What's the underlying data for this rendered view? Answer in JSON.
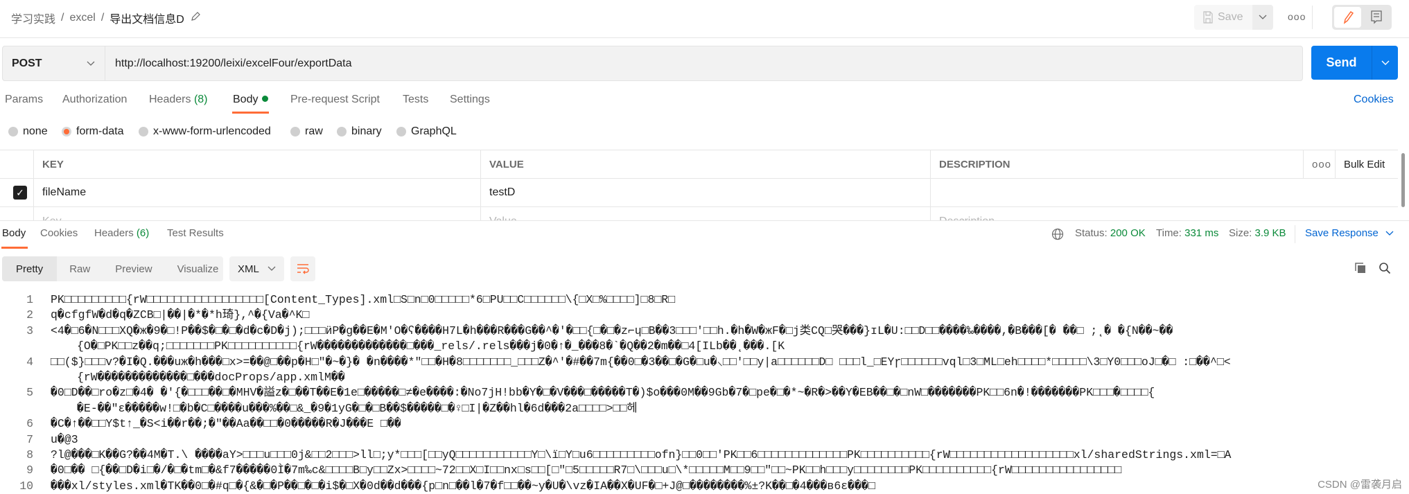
{
  "breadcrumb": {
    "items": [
      "学习实践",
      "excel"
    ],
    "current": "导出文档信息D",
    "separator": "/"
  },
  "header": {
    "save_label": "Save",
    "more": "ooo"
  },
  "request": {
    "method": "POST",
    "url": "http://localhost:19200/leixi/excelFour/exportData",
    "send_label": "Send"
  },
  "tabs": [
    {
      "label": "Params"
    },
    {
      "label": "Authorization"
    },
    {
      "label": "Headers",
      "count": "(8)"
    },
    {
      "label": "Body",
      "active": true
    },
    {
      "label": "Pre-request Script"
    },
    {
      "label": "Tests"
    },
    {
      "label": "Settings"
    }
  ],
  "cookies_label": "Cookies",
  "body_types": [
    {
      "label": "none"
    },
    {
      "label": "form-data",
      "selected": true
    },
    {
      "label": "x-www-form-urlencoded"
    },
    {
      "label": "raw"
    },
    {
      "label": "binary"
    },
    {
      "label": "GraphQL"
    }
  ],
  "table": {
    "headers": [
      "KEY",
      "VALUE",
      "DESCRIPTION"
    ],
    "more": "ooo",
    "bulk_edit": "Bulk Edit",
    "rows": [
      {
        "checked": true,
        "key": "fileName",
        "value": "testD",
        "description": ""
      }
    ],
    "placeholder": {
      "key": "Key",
      "value": "Value",
      "description": "Description"
    }
  },
  "response": {
    "tabs": [
      {
        "label": "Body",
        "active": true
      },
      {
        "label": "Cookies"
      },
      {
        "label": "Headers",
        "count": "(6)"
      },
      {
        "label": "Test Results"
      }
    ],
    "status_label": "Status:",
    "status": "200 OK",
    "time_label": "Time:",
    "time": "331 ms",
    "size_label": "Size:",
    "size": "3.9 KB",
    "save_response": "Save Response",
    "views": [
      "Pretty",
      "Raw",
      "Preview",
      "Visualize"
    ],
    "active_view": "Pretty",
    "format": "XML"
  },
  "colors": {
    "accent": "#FF6C37",
    "primary": "#097BED",
    "link": "#0265D2",
    "success": "#0B8A3A"
  },
  "code_lines": [
    {
      "n": "1",
      "segs": [
        [
          "PK□□□□□□□□□{rW□□□□□□□□□□□□□□□□□[Content_Types].xml□S□n□0□□□□□*6□PU□□C□□□□□□\\{□X□%□□□□]□8□R□",
          ""
        ]
      ]
    },
    {
      "n": "2",
      "segs": [
        [
          "q�cfgfW�d�q�ZCB□|��|�*�*h琦},^�{Va�^K□",
          ""
        ]
      ]
    },
    {
      "n": "3",
      "segs": [
        [
          "<4�□6�N□□□XQ�ж�9�□!P��$�□�□",
          ""
        ],
        [
          "�d�c�D�",
          ""
        ],
        [
          "j);□□□ӥP�g��E�M'O�ʕ����",
          ""
        ],
        [
          "H7L",
          ""
        ],
        [
          "�h���",
          ""
        ],
        [
          "R",
          ""
        ],
        [
          "���G��^�'�□□{□�□�z⌐ɥ□B��3□□□'□□h.�h�W�жF�□j类CQ□哭���}ɪL�U:□□D□□����‰����,�B���[�   ��□ ;˛� �{N��~��",
          ""
        ]
      ]
    },
    {
      "n": "",
      "cont": true,
      "segs": [
        [
          "{O�□PK□□z��q;□□□□□□□PK□□□□□□□□□□{rW�������������□���_rels/.rels���j�0�↑�_���8�`�Q��2�m��□4[ILb��˛���.[K",
          ""
        ]
      ]
    },
    {
      "n": "4",
      "segs": [
        [
          "□□($}□□□v?�I�Q.���uж�h���□x>=��@□��p�H□\"�~�}�    �n����*\"□□�H�8□□□□□□□_□□□Z�^'�#��7m{��0□�3��□�G�□u�⸜□□'□□y|a□□□□□□D□     □□□l_□EYɼ□□□□□□vql□3□ML□eh□□□□*□□□□□\\3□Y0□□□oJ□�□ :□��^□<",
          ""
        ]
      ]
    },
    {
      "n": "",
      "cont": true,
      "segs": [
        [
          "{rW�������������□���docProps/app.xmlM��",
          ""
        ]
      ]
    },
    {
      "n": "5",
      "segs": [
        [
          "�0□D��□ro�z□�4� �'{�□□□��□�MHV�謚z�□��T��E�1e□�����□≠�e����:�No7jH!bb�Y�□�V���□�����T�)$o���0M��9Gb�7�□pe�□�*~�R�>��Y�EB��□�□nW□�������PK□□6n�!�������PK□□□�□□□□{",
          ""
        ]
      ]
    },
    {
      "n": "",
      "cont": true,
      "segs": [
        [
          "�E-��\"ɛ�����w!□�b�C□����u���%��□&_�9�1yG�□�□B��$�����□�♀□I|�Z��hl�6d���2a□□□□>□□헤",
          ""
        ]
      ]
    },
    {
      "n": "6",
      "segs": [
        [
          "�C�↑��□□Y$t↑_�S<i��r��;�\"��Aa��□□�0�����R�J���E □��",
          ""
        ]
      ]
    },
    {
      "n": "7",
      "segs": [
        [
          "u�@3",
          ""
        ]
      ]
    },
    {
      "n": "8",
      "segs": [
        [
          "?l@���□K��G?��4M�T.\\ ����aY>□□□u□□□0j&□□2□□□>ll□;y*□□□[□□yQ□□□□□□□□□□□Y□\\ï□Y□u6□□□□□□□□□ofn}□□0□□'PK□□6□□□□□□□□□□□□□PK□□□□□□□□□□{rW□□□□□□□□□□□□□□□□□□xl/sharedStrings.xml=□A",
          ""
        ]
      ]
    },
    {
      "n": "9",
      "segs": [
        [
          "�0□�� □{��□D�i□�/�□�tm□�&f7�����0Ì�7m‰c&□□□□B□y□□Zx>□□□□~72□□X□I□□nx□s□□[□\"□5□□□□□R7□\\□□□u□\\*□□□□□M□□9□□\"□□~PK□□h□□□y□□□□□□□□PK□□□□□□□□□□{rW□□□□□□□□□□□□□□□□",
          ""
        ]
      ]
    },
    {
      "n": "10",
      "segs": [
        [
          "���xl/styles.xml�TK��0□�#q□�{&�□�P��□�□�i$�□X�0d��d���{p□n□��l�7�f□□��~y�U�\\vz�IA��X�UF�□+J@□��������%±?K��□�4���ʙ6ɛ���□",
          ""
        ]
      ]
    }
  ],
  "watermark": "CSDN @雷袭月启"
}
